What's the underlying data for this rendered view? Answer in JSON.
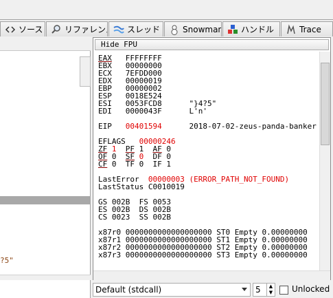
{
  "tabs": [
    {
      "label": "ソース",
      "icon": "source-icon"
    },
    {
      "label": "リファレンス",
      "icon": "search-icon"
    },
    {
      "label": "スレッド",
      "icon": "threads-icon"
    },
    {
      "label": "Snowman",
      "icon": "snowman-icon"
    },
    {
      "label": "ハンドル",
      "icon": "handles-icon"
    },
    {
      "label": "Trace",
      "icon": "trace-icon"
    }
  ],
  "register_panel": {
    "hide_fpu_label": "Hide FPU",
    "lines": [
      "EAX   FFFFFFFF",
      "EBX   00000000",
      "ECX   7EFDD000",
      "EDX   00000019",
      "EBP   00000002",
      "ESP   0018E524",
      "ESI   0053FCD8      \"}4?5\"",
      "EDI   0000043F      L'n'",
      "",
      "EIP   00401594      2018-07-02-zeus-panda-banker",
      "",
      "EFLAGS   00000246",
      "ZF 1  PF 1  AF 0",
      "OF 0  SF 0  DF 0",
      "CF 0  TF 0  IF 1",
      "",
      "LastError  00000003 (ERROR_PATH_NOT_FOUND)",
      "LastStatus C0010019",
      "",
      "GS 002B  FS 0053",
      "ES 002B  DS 002B",
      "CS 0023  SS 002B",
      "",
      "x87r0 0000000000000000000 ST0 Empty 0.00000000",
      "x87r1 0000000000000000000 ST1 Empty 0.00000000",
      "x87r2 0000000000000000000 ST2 Empty 0.00000000",
      "x87r3 0000000000000000000 ST3 Empty 0.00000000"
    ]
  },
  "left_pane": {
    "visible_text": "?5\""
  },
  "bottom_bar": {
    "calling_convention": "Default (stdcall)",
    "arg_count": "5",
    "unlocked_label": "Unlocked",
    "unlocked_checked": false
  },
  "colors": {
    "changed_value": "#e00000",
    "flag_underline": "#8b0000"
  }
}
